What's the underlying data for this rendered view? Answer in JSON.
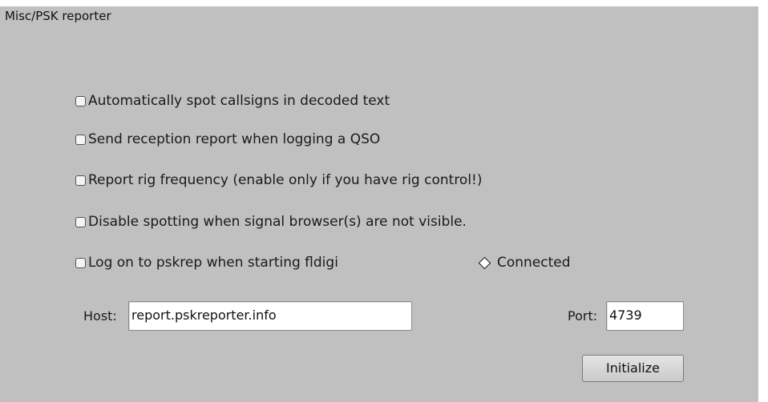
{
  "panel": {
    "title": "Misc/PSK reporter"
  },
  "options": [
    {
      "label": "Automatically spot callsigns in decoded text",
      "checked": false
    },
    {
      "label": "Send reception report when logging a QSO",
      "checked": false
    },
    {
      "label": "Report rig frequency (enable only if you have rig control!)",
      "checked": false
    },
    {
      "label": "Disable spotting when signal browser(s) are not visible.",
      "checked": false
    },
    {
      "label": "Log on to pskrep when starting fldigi",
      "checked": false
    }
  ],
  "status": {
    "label": "Connected",
    "active": false
  },
  "host": {
    "label": "Host:",
    "value": "report.pskreporter.info"
  },
  "port": {
    "label": "Port:",
    "value": "4739"
  },
  "buttons": {
    "initialize": "Initialize"
  }
}
